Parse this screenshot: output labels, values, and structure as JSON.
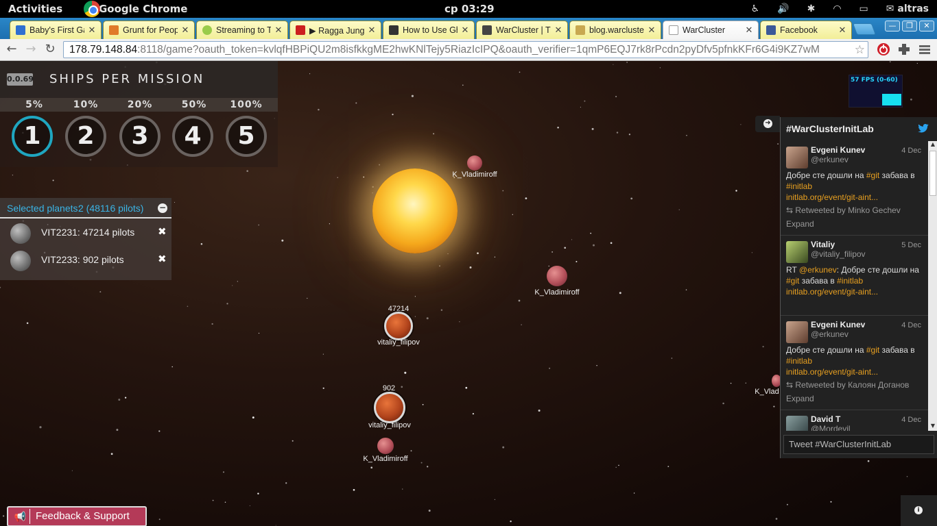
{
  "topbar": {
    "activities": "Activities",
    "app_name": "Google Chrome",
    "clock": "ср 03:29",
    "user": "altras"
  },
  "tabs": [
    {
      "label": "Baby's First Gar",
      "favicon_color": "#2f6fd0",
      "active": false
    },
    {
      "label": "Grunt for Peop",
      "favicon_color": "#e07a2a",
      "active": false
    },
    {
      "label": "Streaming to Tw",
      "favicon_color": "#9acb4a",
      "active": false
    },
    {
      "label": "▶ Ragga Jungle",
      "favicon_color": "#cc1f1f",
      "active": false
    },
    {
      "label": "How to Use Gho",
      "favicon_color": "#333333",
      "active": false
    },
    {
      "label": "WarCluster | Tre",
      "favicon_color": "#444444",
      "active": false
    },
    {
      "label": "blog.warcluster",
      "favicon_color": "#c8a850",
      "active": false
    },
    {
      "label": "WarCluster",
      "favicon_color": "#bbbbbb",
      "active": true
    },
    {
      "label": "Facebook",
      "favicon_color": "#3b5998",
      "active": false
    }
  ],
  "omnibox": {
    "host": "178.79.148.84",
    "rest": ":8118/game?oauth_token=kvlqfHBPiQU2m8isfkkgME2hwKNlTejy5RiazIcIPQ&oauth_verifier=1qmP6EQJ7rk8rPcdn2pyDfv5pfnkKFr6G4i9KZ7wM"
  },
  "ships_panel": {
    "version": "0.0.69",
    "title": "SHIPS PER MISSION",
    "options": [
      {
        "pct": "5%",
        "key": "1",
        "selected": true
      },
      {
        "pct": "10%",
        "key": "2",
        "selected": false
      },
      {
        "pct": "20%",
        "key": "3",
        "selected": false
      },
      {
        "pct": "50%",
        "key": "4",
        "selected": false
      },
      {
        "pct": "100%",
        "key": "5",
        "selected": false
      }
    ]
  },
  "selected_planets": {
    "label": "Selected planets:",
    "count": "2 (48116 pilots)",
    "items": [
      {
        "name": "VIT2231: 47214 pilots"
      },
      {
        "name": "VIT2233: 902 pilots"
      }
    ]
  },
  "map": {
    "planets": [
      {
        "owner": "K_Vladimiroff"
      },
      {
        "owner": "K_Vladimiroff"
      },
      {
        "owner": "vitaliy_filipov",
        "ships": "47214"
      },
      {
        "owner": "vitaliy_filipov",
        "ships": "902"
      },
      {
        "owner": "K_Vladimiroff"
      },
      {
        "owner": "K_Vlad"
      }
    ]
  },
  "fps": {
    "label": "57 FPS (0-60)"
  },
  "twitter": {
    "hashtag": "#WarClusterInitLab",
    "tweets": [
      {
        "name": "Evgeni Kunev",
        "handle": "@erkunev",
        "date": "4 Dec",
        "text_pre": "Добре сте дошли на ",
        "tag1": "#git",
        "text_mid": " забава в ",
        "tag2": "#initlab",
        "link": "initlab.org/event/git-aint...",
        "retweet": "Retweeted by Minko Gechev",
        "expand": "Expand"
      },
      {
        "name": "Vitaliy",
        "handle": "@vitaliy_filipov",
        "date": "5 Dec",
        "text_pre": "RT ",
        "mention": "@erkunev",
        "text_mid": ": Добре сте дошли на ",
        "tag1": "#git",
        "text_mid2": " забава в ",
        "tag2": "#initlab",
        "link": "initlab.org/event/git-aint..."
      },
      {
        "name": "Evgeni Kunev",
        "handle": "@erkunev",
        "date": "4 Dec",
        "text_pre": "Добре сте дошли на ",
        "tag1": "#git",
        "text_mid": " забава в ",
        "tag2": "#initlab",
        "link": "initlab.org/event/git-aint...",
        "retweet": "Retweeted by Калоян Доганов",
        "expand": "Expand"
      },
      {
        "name": "David T",
        "handle": "@Mordevil",
        "date": "4 Dec"
      }
    ],
    "tweet_box": "Tweet #WarClusterInitLab"
  },
  "feedback": {
    "label": "Feedback & Support"
  }
}
